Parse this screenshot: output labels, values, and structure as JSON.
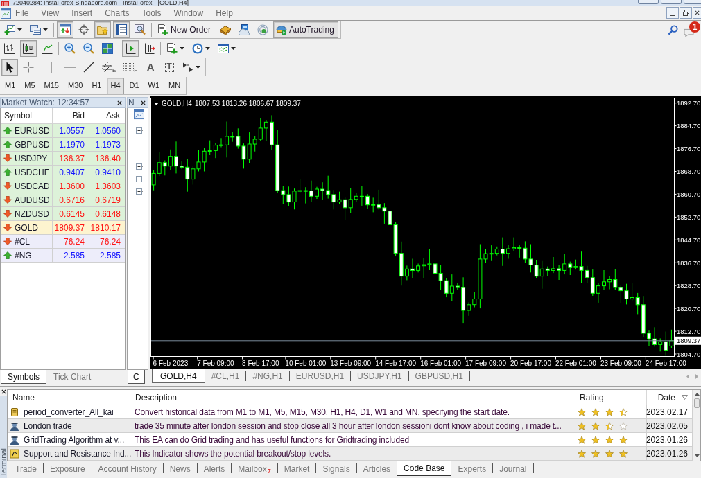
{
  "window": {
    "title": "72040284: InstaForex-Singapore.com - InstaForex - [GOLD,H4]"
  },
  "menu": [
    "File",
    "View",
    "Insert",
    "Charts",
    "Tools",
    "Window",
    "Help"
  ],
  "toolbars": [
    {
      "groups": [
        [
          {
            "kind": "new-chart",
            "dropdown": true,
            "pressed": false
          },
          {
            "kind": "profiles",
            "dropdown": true,
            "pressed": false
          }
        ],
        [
          {
            "kind": "market-watch",
            "dropdown": false,
            "pressed": true
          },
          {
            "kind": "data-window",
            "dropdown": false,
            "pressed": false
          },
          {
            "kind": "navigator",
            "dropdown": false,
            "pressed": true
          },
          {
            "kind": "terminal",
            "dropdown": false,
            "pressed": true
          },
          {
            "kind": "tester",
            "dropdown": false,
            "pressed": false
          }
        ],
        [
          {
            "kind": "new-order",
            "label": "New Order",
            "dropdown": false,
            "pressed": false
          },
          {
            "kind": "editor",
            "dropdown": false,
            "pressed": false
          },
          {
            "kind": "community",
            "dropdown": false,
            "pressed": false
          },
          {
            "kind": "signals",
            "dropdown": false,
            "pressed": false
          },
          {
            "kind": "autotrading",
            "label": "AutoTrading",
            "dropdown": false,
            "pressed": true
          }
        ]
      ]
    },
    {
      "groups": [
        [
          {
            "kind": "bar-chart",
            "dropdown": false,
            "pressed": false
          },
          {
            "kind": "candlesticks",
            "dropdown": false,
            "pressed": true
          },
          {
            "kind": "line-chart",
            "dropdown": false,
            "pressed": false
          }
        ],
        [
          {
            "kind": "zoom-in",
            "dropdown": false,
            "pressed": false
          },
          {
            "kind": "zoom-out",
            "dropdown": false,
            "pressed": false
          },
          {
            "kind": "tile",
            "dropdown": false,
            "pressed": false
          }
        ],
        [
          {
            "kind": "chart-shift",
            "dropdown": false,
            "pressed": true
          },
          {
            "kind": "auto-scroll",
            "dropdown": false,
            "pressed": false
          }
        ],
        [
          {
            "kind": "indicators",
            "dropdown": true,
            "pressed": false
          },
          {
            "kind": "periods",
            "dropdown": true,
            "pressed": false
          },
          {
            "kind": "templates",
            "dropdown": true,
            "pressed": false
          }
        ]
      ]
    },
    {
      "groups": [
        [
          {
            "kind": "cursor",
            "dropdown": false,
            "pressed": true
          },
          {
            "kind": "crosshair",
            "dropdown": false,
            "pressed": false
          }
        ],
        [
          {
            "kind": "vertical-line",
            "dropdown": false,
            "pressed": false
          },
          {
            "kind": "horizontal-line",
            "dropdown": false,
            "pressed": false
          },
          {
            "kind": "trendline",
            "dropdown": false,
            "pressed": false
          },
          {
            "kind": "channel",
            "sub": "E",
            "dropdown": false,
            "pressed": false
          },
          {
            "kind": "fibonacci",
            "sub": "F",
            "dropdown": false,
            "pressed": false
          },
          {
            "kind": "text-tool",
            "label": "A",
            "dropdown": false,
            "pressed": false
          },
          {
            "kind": "label-tool",
            "label": "T",
            "dropdown": false,
            "pressed": false
          },
          {
            "kind": "arrows",
            "dropdown": true,
            "pressed": false
          }
        ]
      ]
    }
  ],
  "timeframes": [
    {
      "label": "M1",
      "selected": false
    },
    {
      "label": "M5",
      "selected": false
    },
    {
      "label": "M15",
      "selected": false
    },
    {
      "label": "M30",
      "selected": false
    },
    {
      "label": "H1",
      "selected": false
    },
    {
      "label": "H4",
      "selected": true
    },
    {
      "label": "D1",
      "selected": false
    },
    {
      "label": "W1",
      "selected": false
    },
    {
      "label": "MN",
      "selected": false
    }
  ],
  "notifications": {
    "count": "1"
  },
  "market_watch": {
    "title": "Market Watch: 12:34:57",
    "columns": [
      "Symbol",
      "Bid",
      "Ask"
    ],
    "rows": [
      {
        "symbol": "EURUSD",
        "bid": "1.0557",
        "ask": "1.0560",
        "rising": true,
        "color": "#ddf2d9"
      },
      {
        "symbol": "GBPUSD",
        "bid": "1.1970",
        "ask": "1.1973",
        "rising": true,
        "color": "#ddf2d9"
      },
      {
        "symbol": "USDJPY",
        "bid": "136.37",
        "ask": "136.40",
        "rising": false,
        "color": "#ddf2d9"
      },
      {
        "symbol": "USDCHF",
        "bid": "0.9407",
        "ask": "0.9410",
        "rising": true,
        "color": "#ddf2d9"
      },
      {
        "symbol": "USDCAD",
        "bid": "1.3600",
        "ask": "1.3603",
        "rising": false,
        "color": "#ddf2d9"
      },
      {
        "symbol": "AUDUSD",
        "bid": "0.6716",
        "ask": "0.6719",
        "rising": false,
        "color": "#ddf2d9"
      },
      {
        "symbol": "NZDUSD",
        "bid": "0.6145",
        "ask": "0.6148",
        "rising": false,
        "color": "#ddf2d9"
      },
      {
        "symbol": "GOLD",
        "bid": "1809.37",
        "ask": "1810.17",
        "rising": false,
        "color": "#fdf4cf"
      },
      {
        "symbol": "#CL",
        "bid": "76.24",
        "ask": "76.24",
        "rising": false,
        "color": "#ededfa"
      },
      {
        "symbol": "#NG",
        "bid": "2.585",
        "ask": "2.585",
        "rising": true,
        "color": "#ededfa"
      }
    ],
    "tabs": [
      {
        "label": "Symbols",
        "selected": true
      },
      {
        "label": "Tick Chart",
        "selected": false
      }
    ]
  },
  "navigator": {
    "title": "N",
    "nodes": [
      {
        "expanded": true
      },
      {
        "expanded": false
      },
      {
        "expanded": false
      },
      {
        "expanded": false
      }
    ],
    "tabs": [
      {
        "label": "C",
        "selected": true
      }
    ]
  },
  "chart": {
    "symbol": "GOLD,H4",
    "quote": "1807.53 1813.26 1806.67 1809.37",
    "chart_data": {
      "type": "candlestick",
      "categories": [
        null,
        null,
        null,
        "6 Feb 2023",
        null,
        null,
        null,
        null,
        null,
        null,
        null,
        "7 Feb 09:00",
        null,
        null,
        null,
        null,
        null,
        null,
        null,
        "8 Feb 17:00",
        null,
        null,
        null,
        null,
        null,
        null,
        null,
        "10 Feb 01:00",
        null,
        null,
        null,
        null,
        null,
        null,
        null,
        "13 Feb 09:00",
        null,
        null,
        null,
        null,
        null,
        null,
        null,
        "14 Feb 17:00",
        null,
        null,
        null,
        null,
        null,
        null,
        null,
        "16 Feb 01:00",
        null,
        null,
        null,
        null,
        null,
        null,
        null,
        "17 Feb 09:00",
        null,
        null,
        null,
        null,
        null,
        null,
        null,
        "20 Feb 17:00",
        null,
        null,
        null,
        null,
        null,
        null,
        null,
        "22 Feb 01:00",
        null,
        null,
        null,
        null,
        null,
        null,
        null,
        "23 Feb 09:00",
        null,
        null,
        null,
        null,
        null,
        null,
        null,
        "24 Feb 17:00",
        null
      ],
      "ohlc": [
        [
          1864,
          1869.2,
          1862.1,
          1868
        ],
        [
          1868,
          1875.4,
          1867.1,
          1871.8
        ],
        [
          1871.8,
          1872.6,
          1867.3,
          1870.6
        ],
        [
          1870.6,
          1876.4,
          1869.2,
          1874
        ],
        [
          1874,
          1879.2,
          1868,
          1870.6
        ],
        [
          1870.6,
          1872.2,
          1869.5,
          1870.2
        ],
        [
          1870.2,
          1873,
          1861.6,
          1866
        ],
        [
          1866,
          1870.5,
          1864.1,
          1869.6
        ],
        [
          1869.6,
          1876.1,
          1868.7,
          1872
        ],
        [
          1872,
          1877,
          1868.7,
          1875.8
        ],
        [
          1875.8,
          1879.6,
          1874.4,
          1876
        ],
        [
          1876,
          1878.7,
          1873.4,
          1877.9
        ],
        [
          1877.9,
          1880.4,
          1877.2,
          1878
        ],
        [
          1878,
          1886.2,
          1873.6,
          1881
        ],
        [
          1881,
          1882.6,
          1879.1,
          1881
        ],
        [
          1881,
          1883.8,
          1876.7,
          1877.6
        ],
        [
          1877.6,
          1878.5,
          1869.7,
          1873
        ],
        [
          1873,
          1882.4,
          1871.6,
          1878.3
        ],
        [
          1878.3,
          1881.2,
          1875.7,
          1880
        ],
        [
          1880,
          1887.5,
          1879.3,
          1883.9
        ],
        [
          1883.9,
          1886.8,
          1879.5,
          1886
        ],
        [
          1886,
          1888.4,
          1876.1,
          1878
        ],
        [
          1878,
          1883.2,
          1861.1,
          1862
        ],
        [
          1862,
          1863.6,
          1857.3,
          1860.6
        ],
        [
          1860.6,
          1863.4,
          1856.6,
          1858
        ],
        [
          1858,
          1862.7,
          1855.4,
          1861.8
        ],
        [
          1861.8,
          1866.1,
          1861.1,
          1862
        ],
        [
          1862,
          1863.2,
          1857.5,
          1861.9
        ],
        [
          1861.9,
          1865.5,
          1858.1,
          1860
        ],
        [
          1860,
          1863.3,
          1859.1,
          1862.5
        ],
        [
          1862.5,
          1864.9,
          1858.7,
          1862
        ],
        [
          1862,
          1867.2,
          1859.2,
          1860.6
        ],
        [
          1860.6,
          1862.2,
          1855.4,
          1858
        ],
        [
          1858,
          1861.6,
          1857.3,
          1858.8
        ],
        [
          1858.8,
          1859.7,
          1851.6,
          1856
        ],
        [
          1856,
          1863,
          1854.1,
          1858.9
        ],
        [
          1858.9,
          1861.2,
          1858,
          1860
        ],
        [
          1860,
          1863.6,
          1856.7,
          1860
        ],
        [
          1860,
          1860.8,
          1855.6,
          1857
        ],
        [
          1857,
          1859.5,
          1854.4,
          1857.1
        ],
        [
          1857.1,
          1862.3,
          1855.3,
          1856
        ],
        [
          1856,
          1857.6,
          1850.4,
          1854.8
        ],
        [
          1854.8,
          1857.6,
          1848.1,
          1850
        ],
        [
          1850,
          1850.9,
          1839.1,
          1840
        ],
        [
          1840,
          1844.1,
          1828.7,
          1832
        ],
        [
          1832,
          1835.7,
          1830.6,
          1834.5
        ],
        [
          1834.5,
          1838.1,
          1831.4,
          1834
        ],
        [
          1834,
          1836.4,
          1833.3,
          1835.6
        ],
        [
          1835.6,
          1838.4,
          1831.2,
          1836
        ],
        [
          1836,
          1841.5,
          1834.1,
          1836.3
        ],
        [
          1836.3,
          1837.9,
          1832.1,
          1833
        ],
        [
          1833,
          1835.8,
          1827.1,
          1830.4
        ],
        [
          1830.4,
          1831.3,
          1824.6,
          1826
        ],
        [
          1826,
          1832.6,
          1823.4,
          1828.5
        ],
        [
          1828.5,
          1829.7,
          1827.3,
          1828
        ],
        [
          1828,
          1831.6,
          1815.6,
          1820
        ],
        [
          1820,
          1822.8,
          1818.1,
          1822
        ],
        [
          1822,
          1826.4,
          1821.1,
          1824
        ],
        [
          1824,
          1843.2,
          1820.7,
          1838
        ],
        [
          1838,
          1841.5,
          1836.6,
          1839.9
        ],
        [
          1839.9,
          1842.8,
          1837.3,
          1840
        ],
        [
          1840,
          1842.4,
          1839.3,
          1841.5
        ],
        [
          1841.5,
          1845.6,
          1835.6,
          1840
        ],
        [
          1840,
          1842.8,
          1838.1,
          1841.6
        ],
        [
          1841.6,
          1845.6,
          1840.7,
          1842
        ],
        [
          1842,
          1842.8,
          1838.5,
          1841.8
        ],
        [
          1841.8,
          1844.2,
          1836.6,
          1838
        ],
        [
          1838,
          1843.2,
          1833.3,
          1835.9
        ],
        [
          1835.9,
          1837.5,
          1831.3,
          1832
        ],
        [
          1832,
          1837.3,
          1827.6,
          1834.5
        ],
        [
          1834.5,
          1835.4,
          1832.1,
          1834
        ],
        [
          1834,
          1838.7,
          1833.1,
          1834.6
        ],
        [
          1834.6,
          1835.8,
          1830.7,
          1834
        ],
        [
          1834,
          1839.9,
          1832.6,
          1836.3
        ],
        [
          1836.3,
          1837.1,
          1832.4,
          1835
        ],
        [
          1835,
          1837.8,
          1834.3,
          1835.4
        ],
        [
          1835.4,
          1840.6,
          1829.6,
          1834
        ],
        [
          1834,
          1835.6,
          1829.6,
          1831.5
        ],
        [
          1831.5,
          1834.3,
          1825.1,
          1826
        ],
        [
          1826,
          1829.5,
          1822.7,
          1828.6
        ],
        [
          1828.6,
          1834.1,
          1827.2,
          1830
        ],
        [
          1830,
          1832,
          1827.4,
          1830.8
        ],
        [
          1830.8,
          1834.4,
          1827.3,
          1828
        ],
        [
          1828,
          1828.8,
          1822.5,
          1826.9
        ],
        [
          1826.9,
          1829.3,
          1822.1,
          1824
        ],
        [
          1824,
          1829.7,
          1823.1,
          1824.5
        ],
        [
          1824.5,
          1826.1,
          1818.7,
          1822
        ],
        [
          1822,
          1824.8,
          1810.6,
          1812
        ],
        [
          1812,
          1812.9,
          1807.4,
          1810
        ],
        [
          1810,
          1814.1,
          1807.3,
          1808
        ],
        [
          1808,
          1810.2,
          1805.6,
          1809
        ],
        [
          1809,
          1812.6,
          1804.1,
          1806
        ],
        [
          1807.53,
          1813.26,
          1806.67,
          1809.37
        ]
      ],
      "ylim": [
        1803.85,
        1894.45
      ],
      "yticks": [
        {
          "value": 1892.7,
          "label": "1892.70"
        },
        {
          "value": 1884.7,
          "label": "1884.70"
        },
        {
          "value": 1876.7,
          "label": "1876.70"
        },
        {
          "value": 1868.7,
          "label": "1868.70"
        },
        {
          "value": 1860.7,
          "label": "1860.70"
        },
        {
          "value": 1852.7,
          "label": "1852.70"
        },
        {
          "value": 1844.7,
          "label": "1844.70"
        },
        {
          "value": 1836.7,
          "label": "1836.70"
        },
        {
          "value": 1828.7,
          "label": "1828.70"
        },
        {
          "value": 1820.7,
          "label": "1820.70"
        },
        {
          "value": 1812.7,
          "label": "1812.70"
        },
        {
          "value": 1804.7,
          "label": "1804.70"
        }
      ],
      "ref_lines": [
        {
          "axis": "y",
          "value": 1809.37,
          "label": "1809.37"
        }
      ]
    }
  },
  "chart_tabs": [
    {
      "label": "GOLD,H4",
      "selected": true
    },
    {
      "label": "#CL,H1",
      "selected": false
    },
    {
      "label": "#NG,H1",
      "selected": false
    },
    {
      "label": "EURUSD,H1",
      "selected": false
    },
    {
      "label": "USDJPY,H1",
      "selected": false
    },
    {
      "label": "GBPUSD,H1",
      "selected": false
    }
  ],
  "terminal": {
    "title": "Terminal",
    "columns": [
      {
        "label": "Name",
        "sorted": false
      },
      {
        "label": "Description",
        "sorted": false
      },
      {
        "label": "Rating",
        "sorted": false
      },
      {
        "label": "Date",
        "sorted": true
      }
    ],
    "rows": [
      {
        "kind": "script",
        "name": "period_converter_All_kai",
        "description": "Convert historical data from M1 to M1, M5, M15, M30, H1, H4, D1, W1 and MN, specifying the start date.",
        "stars": 3.5,
        "date": "2023.02.17"
      },
      {
        "kind": "expert",
        "name": "London trade",
        "description": "trade 35 minute after london session and stop close all 3 hour after london sessioni dont know about coding , i made t...",
        "stars": 2.5,
        "date": "2023.02.05"
      },
      {
        "kind": "expert",
        "name": "GridTrading Algorithm at v...",
        "description": "This EA can do Grid trading and has useful functions for Gridtrading included",
        "stars": 4,
        "date": "2023.01.26"
      },
      {
        "kind": "indicator",
        "name": "Support and Resistance Ind...",
        "description": "This Indicator shows the potential breakout/stop levels.",
        "stars": 4,
        "date": "2023.01.26"
      }
    ],
    "tabs": [
      {
        "label": "Trade",
        "selected": false
      },
      {
        "label": "Exposure",
        "selected": false
      },
      {
        "label": "Account History",
        "selected": false
      },
      {
        "label": "News",
        "selected": false
      },
      {
        "label": "Alerts",
        "selected": false
      },
      {
        "label": "Mailbox",
        "badge": "7",
        "selected": false
      },
      {
        "label": "Market",
        "selected": false
      },
      {
        "label": "Signals",
        "selected": false
      },
      {
        "label": "Articles",
        "selected": false
      },
      {
        "label": "Code Base",
        "selected": true
      },
      {
        "label": "Experts",
        "selected": false
      },
      {
        "label": "Journal",
        "selected": false
      }
    ]
  }
}
